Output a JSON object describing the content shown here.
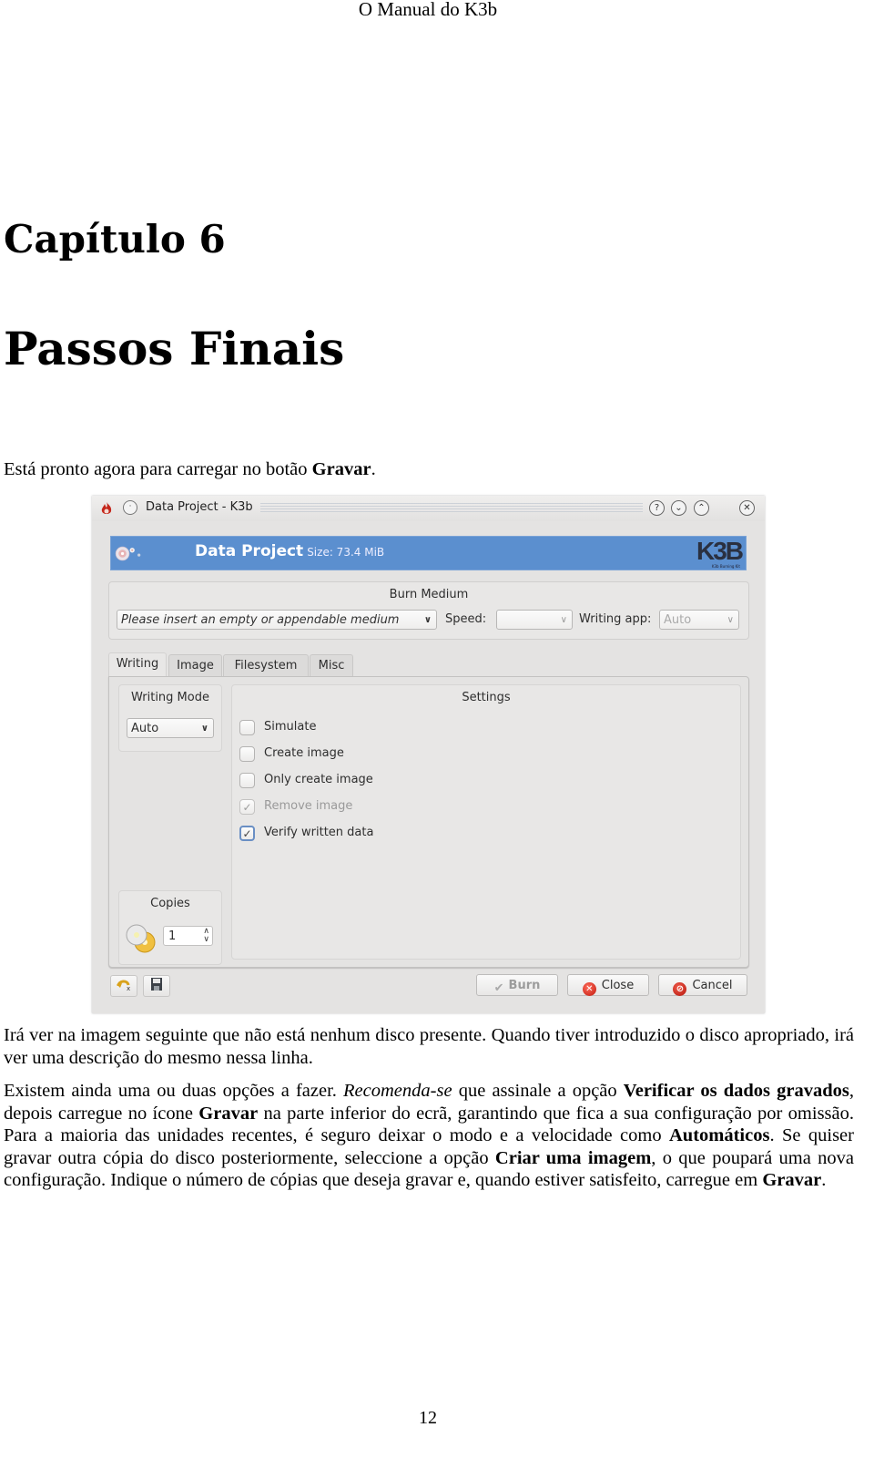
{
  "page": {
    "running_header": "O Manual do K3b",
    "chapter_label": "Capítulo 6",
    "chapter_title": "Passos Finais",
    "intro": {
      "text_before": "Está pronto agora para carregar no botão ",
      "bold": "Gravar",
      "text_after": "."
    },
    "paragraph1": "Irá ver na imagem seguinte que não está nenhum disco presente. Quando tiver introduzido o disco apropriado, irá ver uma descrição do mesmo nessa linha.",
    "paragraph2": {
      "s1": "Existem ainda uma ou duas opções a fazer. ",
      "s2_italic": "Recomenda-se",
      "s3": " que assinale a opção ",
      "s4_bold": "Verificar os dados gravados",
      "s5": ", depois carregue no ícone ",
      "s6_bold": "Gravar",
      "s7": " na parte inferior do ecrã, garantindo que fica a sua configuração por omissão. Para a maioria das unidades recentes, é seguro deixar o modo e a velocidade como ",
      "s8_bold": "Automáticos",
      "s9": ". Se quiser gravar outra cópia do disco posteriormente, seleccione a opção ",
      "s10_bold": "Criar uma imagem",
      "s11": ", o que poupará uma nova configuração. Indique o número de cópias que deseja gravar e, quando estiver satisfeito, carregue em ",
      "s12_bold": "Gravar",
      "s13": "."
    },
    "page_number": "12"
  },
  "window": {
    "title": "Data Project - K3b",
    "titlebar_buttons": {
      "help": "?",
      "minimize": "⌄",
      "maximize": "⌃",
      "close": "✕"
    },
    "banner": {
      "title": "Data Project",
      "size_label": "Size: 73.4 MiB",
      "logo": "K3B",
      "logo_sub": "K3b Burning Kit"
    },
    "burn_medium": {
      "title": "Burn Medium",
      "medium_value": "Please insert an empty or appendable medium",
      "speed_label": "Speed:",
      "speed_value": "",
      "writing_app_label": "Writing app:",
      "writing_app_value": "Auto"
    },
    "tabs": [
      {
        "label": "Writing",
        "active": true
      },
      {
        "label": "Image",
        "active": false
      },
      {
        "label": "Filesystem",
        "active": false
      },
      {
        "label": "Misc",
        "active": false
      }
    ],
    "writing_mode": {
      "title": "Writing Mode",
      "value": "Auto"
    },
    "settings": {
      "title": "Settings",
      "options": [
        {
          "label": "Simulate",
          "checked": false,
          "enabled": true
        },
        {
          "label": "Create image",
          "checked": false,
          "enabled": true
        },
        {
          "label": "Only create image",
          "checked": false,
          "enabled": true
        },
        {
          "label": "Remove image",
          "checked": true,
          "enabled": false
        },
        {
          "label": "Verify written data",
          "checked": true,
          "enabled": true
        }
      ]
    },
    "copies": {
      "title": "Copies",
      "value": "1"
    },
    "buttons": {
      "burn": "Burn",
      "close": "Close",
      "cancel": "Cancel"
    },
    "icons": {
      "check": "✔",
      "checkbox_check": "✓",
      "chevron": "⌄",
      "close_x": "✕",
      "cancel_slash": "⊘"
    }
  }
}
